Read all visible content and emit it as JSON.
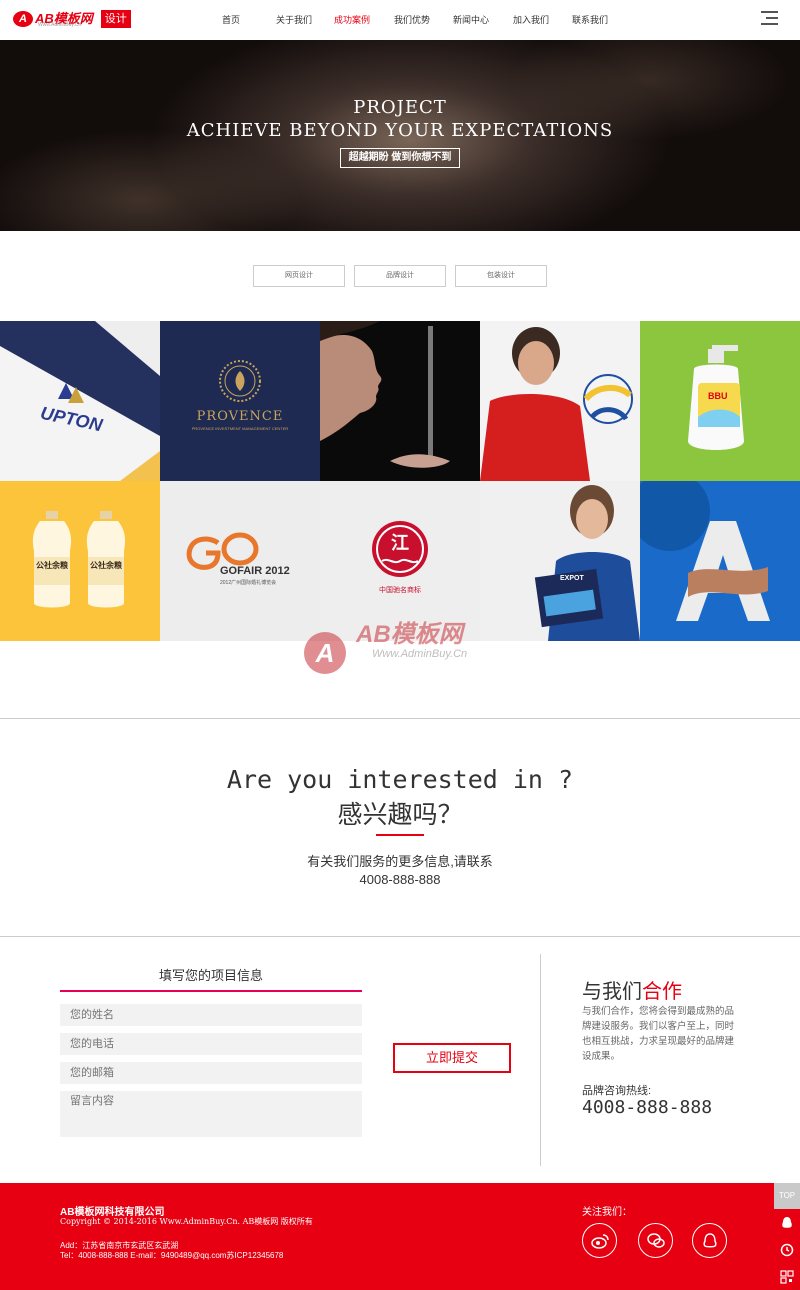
{
  "header": {
    "logo_text": "AB模板网",
    "logo_sub": "Www.AdminBuy.Cn",
    "logo_badge": "设计",
    "nav": [
      {
        "label": "首页",
        "active": false
      },
      {
        "label": "关于我们",
        "active": false
      },
      {
        "label": "成功案例",
        "active": true
      },
      {
        "label": "我们优势",
        "active": false
      },
      {
        "label": "新闻中心",
        "active": false
      },
      {
        "label": "加入我们",
        "active": false
      },
      {
        "label": "联系我们",
        "active": false
      }
    ]
  },
  "banner": {
    "line1": "PROJECT",
    "line2": "ACHIEVE BEYOND YOUR EXPECTATIONS",
    "button": "超越期盼  做到你想不到"
  },
  "tabs": [
    "网页设计",
    "品牌设计",
    "包装设计"
  ],
  "portfolio": {
    "upton": "UPTON",
    "provence": "PROVENCE",
    "provence_sub": "PROVENCE INVESTMENT MANAGEMENT CENTER",
    "bbu": "BBU",
    "bottle": "公社余粮",
    "gofair": "GOFAIR 2012",
    "gofair_sub": "2012广州国际婚礼博览会",
    "jiang_char": "江",
    "jiang_sub": "中国驰名商标",
    "expot": "EXPOT"
  },
  "watermark": {
    "text": "AB模板网",
    "sub": "Www.AdminBuy.Cn"
  },
  "interest": {
    "en": "Are you interested in ?",
    "cn": "感兴趣吗？",
    "desc1": "有关我们服务的更多信息,请联系",
    "desc2": "4008-888-888"
  },
  "form": {
    "title": "填写您的项目信息",
    "name_placeholder": "您的姓名",
    "phone_placeholder": "您的电话",
    "email_placeholder": "您的邮箱",
    "message_placeholder": "留言内容",
    "submit": "立即提交"
  },
  "cooperate": {
    "title_black": "与我们",
    "title_red": "合作",
    "desc": "与我们合作，您将会得到最成熟的品牌建设服务。我们以客户至上，同时也相互挑战，力求呈现最好的品牌建设成果。",
    "hotline_label": "品牌咨询热线:",
    "hotline": "4008-888-888"
  },
  "footer": {
    "company": "AB模板网科技有限公司",
    "copyright": "Copyright © 2014-2016 Www.AdminBuy.Cn. AB模板网 版权所有",
    "address": "Add：江苏省南京市玄武区玄武湖",
    "contact": "Tel：4008-888-888   E-mail：9490489@qq.com苏ICP12345678",
    "follow": "关注我们：",
    "side_top": "TOP"
  },
  "colors": {
    "brand_red": "#e60012",
    "accent_pink": "#e6005a",
    "yellow": "#fbc43a",
    "green": "#8cc63f",
    "navy": "#1e2a52",
    "blue": "#1565c0"
  },
  "icons": {
    "social": [
      "weibo-icon",
      "wechat-icon",
      "qq-icon"
    ],
    "side": [
      "qq-icon",
      "phone-icon",
      "qrcode-icon"
    ]
  }
}
